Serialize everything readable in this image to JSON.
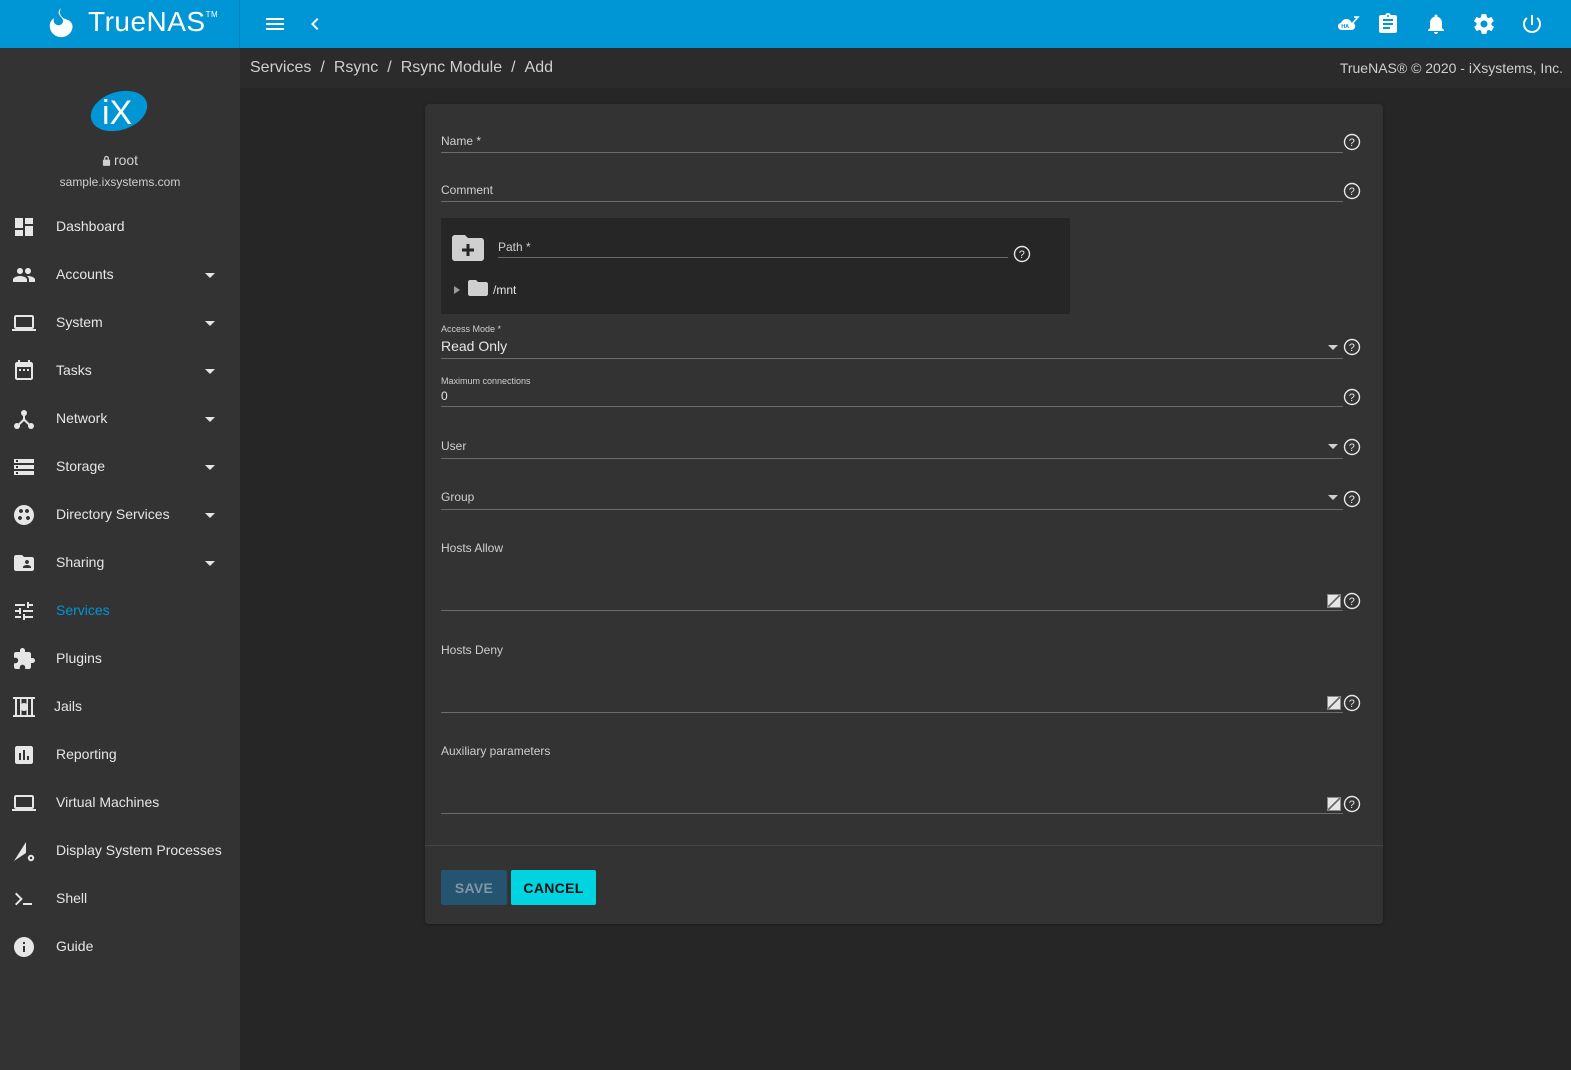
{
  "topbar": {
    "brand": "TrueNAS",
    "brand_tm": "TM",
    "icons": [
      "truenas-logo-icon",
      "menu-icon",
      "collapse-icon",
      "ha-icon",
      "clipboard-icon",
      "bell-icon",
      "gear-icon",
      "power-icon"
    ]
  },
  "sidebar": {
    "user": "root",
    "hostname": "sample.ixsystems.com",
    "items": [
      {
        "label": "Dashboard",
        "icon": "dashboard-icon",
        "expandable": false
      },
      {
        "label": "Accounts",
        "icon": "accounts-icon",
        "expandable": true
      },
      {
        "label": "System",
        "icon": "laptop-icon",
        "expandable": true
      },
      {
        "label": "Tasks",
        "icon": "calendar-icon",
        "expandable": true
      },
      {
        "label": "Network",
        "icon": "network-icon",
        "expandable": true
      },
      {
        "label": "Storage",
        "icon": "storage-icon",
        "expandable": true
      },
      {
        "label": "Directory Services",
        "icon": "directory-services-icon",
        "expandable": true
      },
      {
        "label": "Sharing",
        "icon": "sharing-icon",
        "expandable": true
      },
      {
        "label": "Services",
        "icon": "tune-icon",
        "expandable": false,
        "active": true
      },
      {
        "label": "Plugins",
        "icon": "puzzle-icon",
        "expandable": false
      },
      {
        "label": "Jails",
        "icon": "jail-icon",
        "expandable": false
      },
      {
        "label": "Reporting",
        "icon": "chart-icon",
        "expandable": false
      },
      {
        "label": "Virtual Machines",
        "icon": "computer-icon",
        "expandable": false
      },
      {
        "label": "Display System Processes",
        "icon": "processes-icon",
        "expandable": false
      },
      {
        "label": "Shell",
        "icon": "shell-icon",
        "expandable": false
      },
      {
        "label": "Guide",
        "icon": "info-icon",
        "expandable": false
      }
    ]
  },
  "breadcrumb": {
    "items": [
      "Services",
      "Rsync",
      "Rsync Module",
      "Add"
    ],
    "separator": "/",
    "copyright": "TrueNAS® © 2020 - iXsystems, Inc."
  },
  "form": {
    "name_label": "Name *",
    "comment_label": "Comment",
    "path_label": "Path *",
    "tree_root": "/mnt",
    "access_mode_label": "Access Mode *",
    "access_mode_value": "Read Only",
    "max_conn_label": "Maximum connections",
    "max_conn_value": "0",
    "user_label": "User",
    "group_label": "Group",
    "hosts_allow_label": "Hosts Allow",
    "hosts_deny_label": "Hosts Deny",
    "aux_params_label": "Auxiliary parameters",
    "save_label": "SAVE",
    "cancel_label": "CANCEL"
  },
  "colors": {
    "accent": "#0095d5",
    "cancel_button": "#00d4e0",
    "save_button_disabled": "#24546f",
    "background": "#262626",
    "panel": "#333333"
  }
}
